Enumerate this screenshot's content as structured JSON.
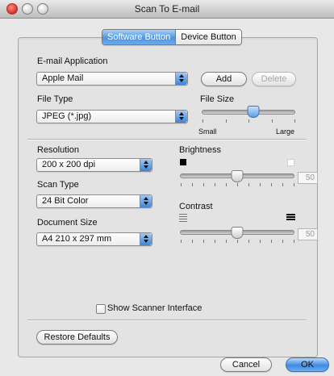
{
  "window": {
    "title": "Scan To E-mail"
  },
  "tabs": {
    "software": "Software Button",
    "device": "Device Button"
  },
  "email_app": {
    "label": "E-mail Application",
    "value": "Apple Mail",
    "add": "Add",
    "delete": "Delete"
  },
  "file_type": {
    "label": "File Type",
    "value": "JPEG (*.jpg)"
  },
  "file_size": {
    "label": "File Size",
    "small": "Small",
    "large": "Large",
    "level": 0.55
  },
  "resolution": {
    "label": "Resolution",
    "value": "200 x 200 dpi"
  },
  "scan_type": {
    "label": "Scan Type",
    "value": "24 Bit Color"
  },
  "document_size": {
    "label": "Document Size",
    "value": "A4  210 x 297 mm"
  },
  "brightness": {
    "label": "Brightness",
    "value": "50",
    "level": 0.5
  },
  "contrast": {
    "label": "Contrast",
    "value": "50",
    "level": 0.5
  },
  "show_scanner": {
    "label": "Show Scanner Interface",
    "checked": false
  },
  "buttons": {
    "restore": "Restore Defaults",
    "cancel": "Cancel",
    "ok": "OK"
  },
  "colors": {
    "accent": "#4f95e1",
    "panel": "#e3e3e3",
    "window": "#e8e8e8"
  }
}
